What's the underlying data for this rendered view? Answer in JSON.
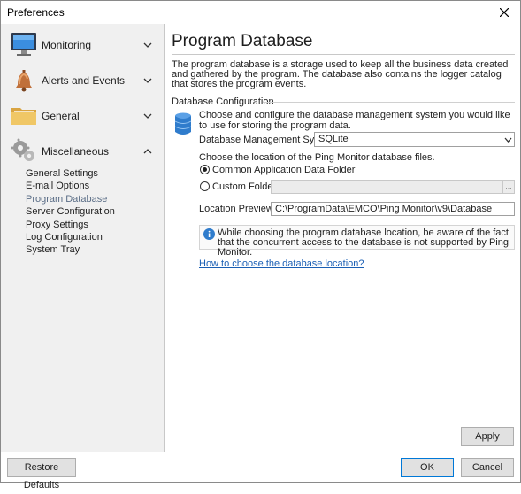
{
  "window": {
    "title": "Preferences"
  },
  "sidebar": {
    "groups": [
      {
        "label": "Monitoring",
        "icon": "monitor-icon",
        "expanded": false
      },
      {
        "label": "Alerts and Events",
        "icon": "bell-icon",
        "expanded": false
      },
      {
        "label": "General",
        "icon": "folder-icon",
        "expanded": false
      },
      {
        "label": "Miscellaneous",
        "icon": "gears-icon",
        "expanded": true
      }
    ],
    "items": [
      {
        "label": "General Settings"
      },
      {
        "label": "E-mail Options"
      },
      {
        "label": "Program Database",
        "active": true
      },
      {
        "label": "Server Configuration"
      },
      {
        "label": "Proxy Settings"
      },
      {
        "label": "Log Configuration"
      },
      {
        "label": "System Tray"
      }
    ]
  },
  "content": {
    "title": "Program Database",
    "description": "The program database is a storage used to keep all the business data created and gathered by the program. The database also contains the logger catalog that stores the program events.",
    "section_label": "Database Configuration",
    "db_description": "Choose and configure the database management system you would like to use for storing the program data.",
    "dbms_label": "Database Management System:",
    "dbms_value": "SQLite",
    "location_heading": "Choose the location of the Ping Monitor database files.",
    "radio_common_label": "Common Application Data Folder",
    "radio_custom_label": "Custom Folder:",
    "browse_label": "...",
    "location_preview_label": "Location Preview:",
    "location_preview_value": "C:\\ProgramData\\EMCO\\Ping Monitor\\v9\\Database",
    "info_text": "While choosing the program database location, be aware of the fact that the concurrent access to the database is not supported by Ping Monitor.",
    "help_link": "How to choose the database location?",
    "apply_label": "Apply"
  },
  "footer": {
    "restore_label": "Restore Defaults",
    "ok_label": "OK",
    "cancel_label": "Cancel"
  },
  "colors": {
    "accent": "#0078d7",
    "link": "#1a5fb4",
    "sidebar_bg": "#f0f0f0",
    "active_item": "#5a6d86"
  }
}
